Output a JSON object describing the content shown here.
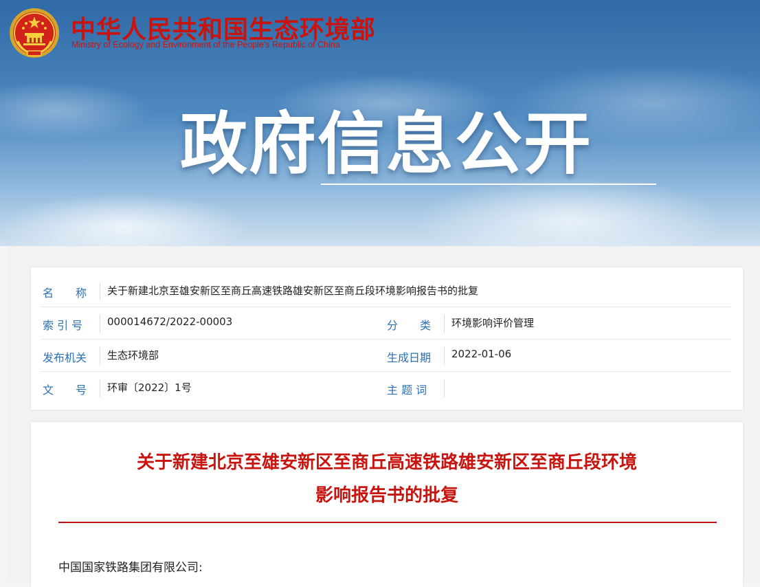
{
  "header": {
    "site_name_cn": "中华人民共和国生态环境部",
    "site_name_en": "Ministry of Ecology and Environment of the People's Republic of China",
    "logo_icon": "national-emblem-icon",
    "banner_title": "政府信息公开"
  },
  "meta": {
    "name_label": "名　　称",
    "name_value": "关于新建北京至雄安新区至商丘高速铁路雄安新区至商丘段环境影响报告书的批复",
    "index_label": "索 引 号",
    "index_value": "000014672/2022-00003",
    "category_label": "分　　类",
    "category_value": "环境影响评价管理",
    "issuer_label": "发布机关",
    "issuer_value": "生态环境部",
    "date_label": "生成日期",
    "date_value": "2022-01-06",
    "docno_label": "文　　号",
    "docno_value": "环审〔2022〕1号",
    "keywords_label": "主 题 词",
    "keywords_value": ""
  },
  "document": {
    "title_line1": "关于新建北京至雄安新区至商丘高速铁路雄安新区至商丘段环境",
    "title_line2": "影响报告书的批复",
    "salutation": "中国国家铁路集团有限公司:"
  },
  "colors": {
    "brand_red": "#c8140f",
    "label_blue": "#2b70b5"
  }
}
